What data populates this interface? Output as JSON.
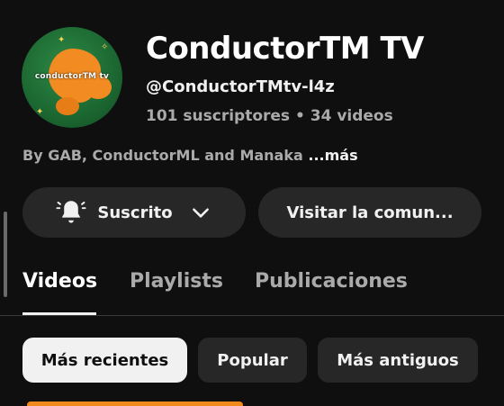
{
  "channel": {
    "avatar_text": "conductorTM tv",
    "title": "ConductorTM TV",
    "handle": "@ConductorTMtv-l4z",
    "stats": "101 suscriptores • 34 videos",
    "description": "By GAB, ConductorML and Manaka",
    "description_more": "...más"
  },
  "actions": {
    "subscribed_label": "Suscrito",
    "community_label": "Visitar la comun..."
  },
  "tabs": [
    {
      "label": "Videos",
      "active": true
    },
    {
      "label": "Playlists",
      "active": false
    },
    {
      "label": "Publicaciones",
      "active": false
    }
  ],
  "chips": [
    {
      "label": "Más recientes",
      "selected": true
    },
    {
      "label": "Popular",
      "selected": false
    },
    {
      "label": "Más antiguos",
      "selected": false
    }
  ],
  "icons": {
    "bell": "bell-icon",
    "chevron": "chevron-down-icon"
  },
  "colors": {
    "background": "#0f0f0f",
    "button_bg": "#272727",
    "secondary_text": "#aaaaaa",
    "avatar_green": "#1d6a33",
    "avatar_orange": "#f28b21"
  }
}
